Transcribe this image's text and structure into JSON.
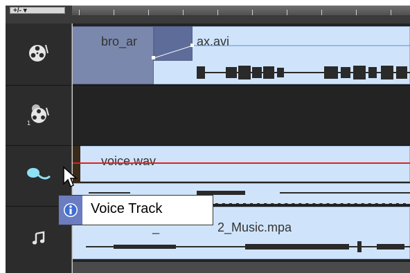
{
  "toolbar": {
    "add_remove_label": "+/- ▾"
  },
  "tracks": [
    {
      "name": "video-track",
      "icon": "film-reel-icon",
      "clip": {
        "left_label": "bro_ar",
        "right_label": "ax.avi"
      }
    },
    {
      "name": "overlay-track-1",
      "icon": "film-reel-overlay-icon",
      "clip": null
    },
    {
      "name": "voice-track",
      "icon": "microphone-icon",
      "clip": {
        "label": "voice.wav"
      }
    },
    {
      "name": "music-track",
      "icon": "music-note-icon",
      "clip": {
        "label_visible": "2_Music.mpa",
        "prefix_visible": "_"
      }
    }
  ],
  "tooltip": {
    "text": "Voice Track",
    "icon": "info-icon"
  },
  "colors": {
    "clip": "#cfe4fb",
    "thumb": "#7b88ad",
    "volume_line": "#e02020",
    "tooltip_icon_bg": "#6b7cc1"
  }
}
